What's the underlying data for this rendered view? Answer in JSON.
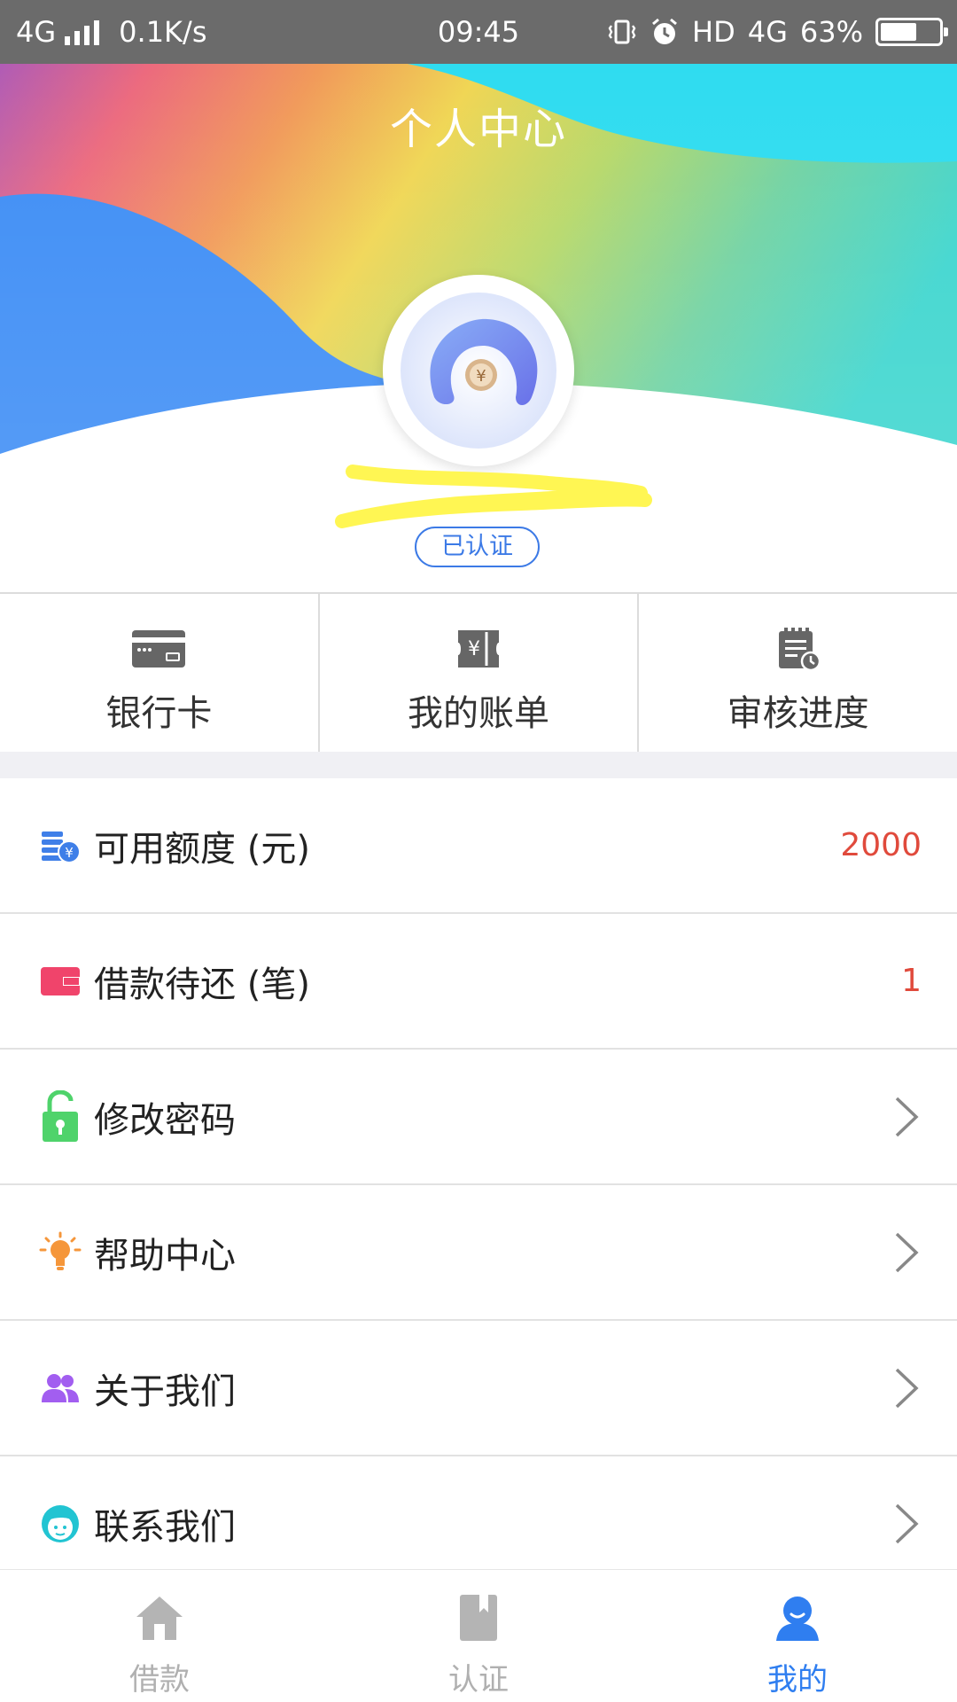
{
  "status_bar": {
    "network": "4G",
    "speed": "0.1K/s",
    "time": "09:45",
    "hd": "HD",
    "network_right": "4G",
    "battery": "63%",
    "battery_level": 0.63
  },
  "header": {
    "title": "个人中心"
  },
  "profile": {
    "verified_label": "已认证"
  },
  "quick_actions": [
    {
      "label": "银行卡",
      "icon": "bank-card-icon"
    },
    {
      "label": "我的账单",
      "icon": "bill-icon"
    },
    {
      "label": "审核进度",
      "icon": "review-progress-icon"
    }
  ],
  "menu": [
    {
      "label": "可用额度 (元)",
      "value": "2000",
      "icon": "coins-icon",
      "color": "#3f7fe8"
    },
    {
      "label": "借款待还 (笔)",
      "value": "1",
      "icon": "wallet-icon",
      "color": "#f0446b"
    },
    {
      "label": "修改密码",
      "icon": "unlock-icon",
      "color": "#4fd36b"
    },
    {
      "label": "帮助中心",
      "icon": "lightbulb-icon",
      "color": "#f5963a"
    },
    {
      "label": "关于我们",
      "icon": "users-icon",
      "color": "#a25ef0"
    },
    {
      "label": "联系我们",
      "icon": "customer-service-icon",
      "color": "#22c4d2"
    }
  ],
  "bottom_nav": [
    {
      "label": "借款",
      "icon": "home-icon",
      "active": false
    },
    {
      "label": "认证",
      "icon": "bookmark-icon",
      "active": false
    },
    {
      "label": "我的",
      "icon": "user-icon",
      "active": true
    }
  ],
  "colors": {
    "accent": "#2f7ef0",
    "value_red": "#e04a3c",
    "status_bar": "#6b6b6b"
  }
}
